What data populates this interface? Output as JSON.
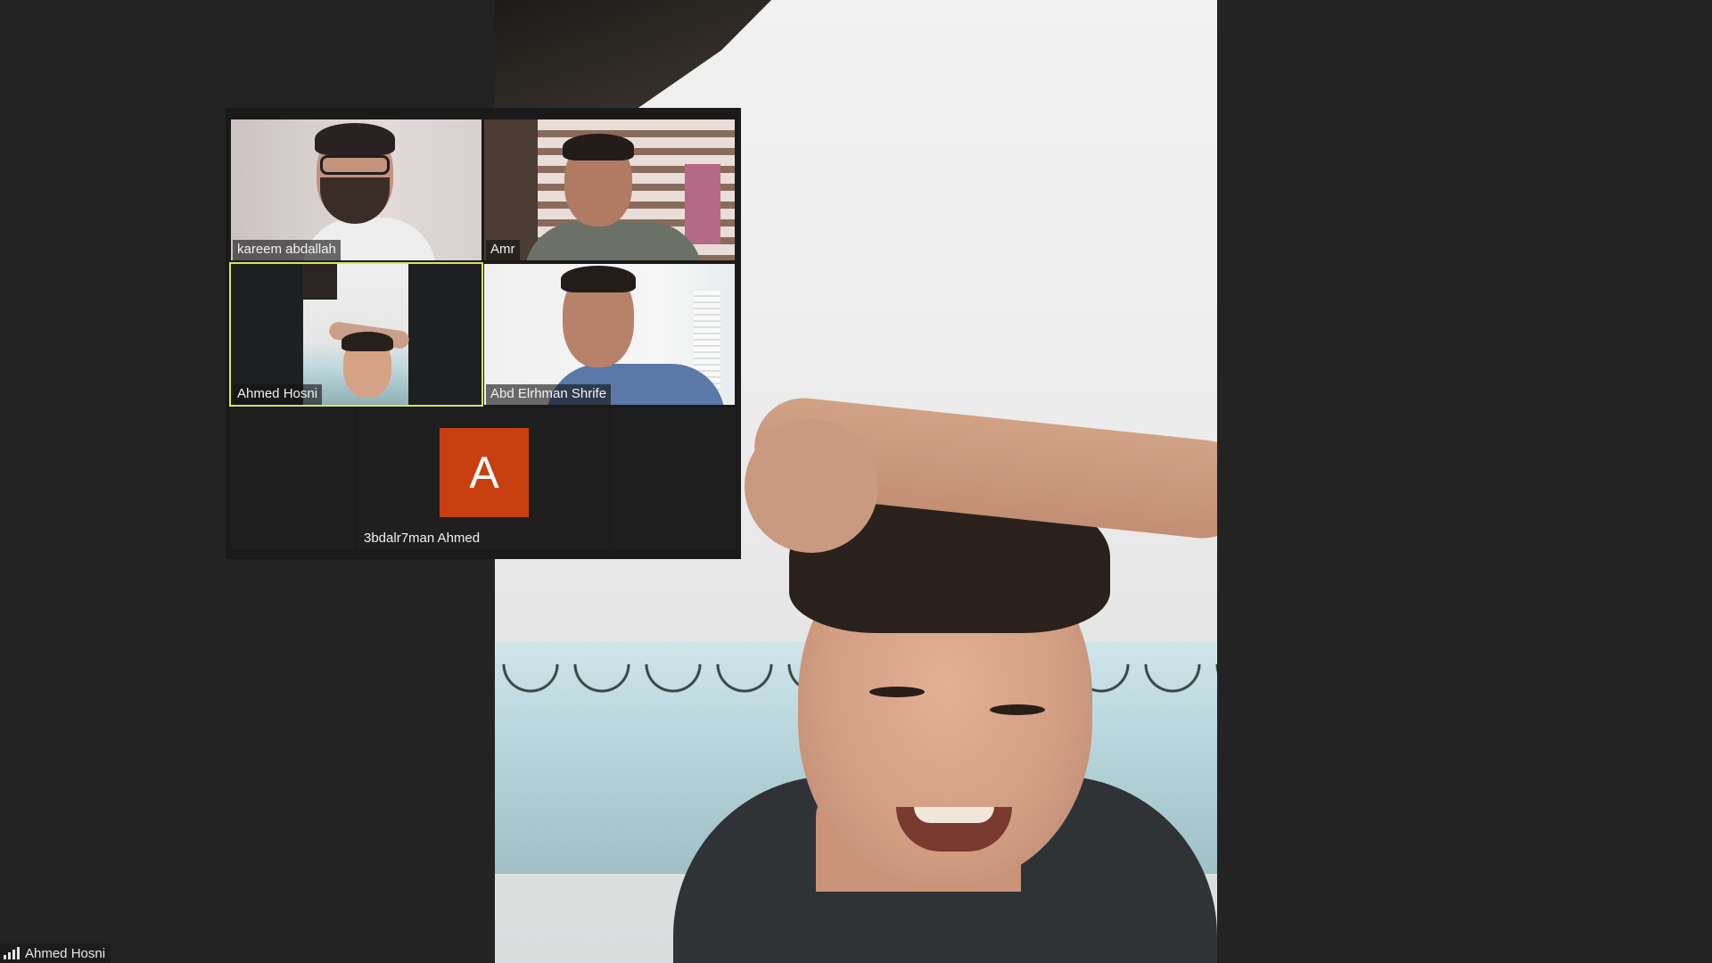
{
  "main_video": {
    "speaker_name": "Ahmed Hosni"
  },
  "gallery": {
    "participants": [
      {
        "name": "kareem abdallah"
      },
      {
        "name": "Amr"
      },
      {
        "name": "Ahmed Hosni",
        "active_speaker": true
      },
      {
        "name": "Abd Elrhman Shrife"
      }
    ],
    "avatar_participant": {
      "initial": "A",
      "name": "3bdalr7man Ahmed",
      "avatar_color": "#c8400f"
    }
  },
  "status_bar": {
    "speaker_label": "Ahmed Hosni",
    "icon": "signal-strength-icon"
  },
  "colors": {
    "background": "#232323",
    "active_speaker_outline": "#d9e35f"
  }
}
